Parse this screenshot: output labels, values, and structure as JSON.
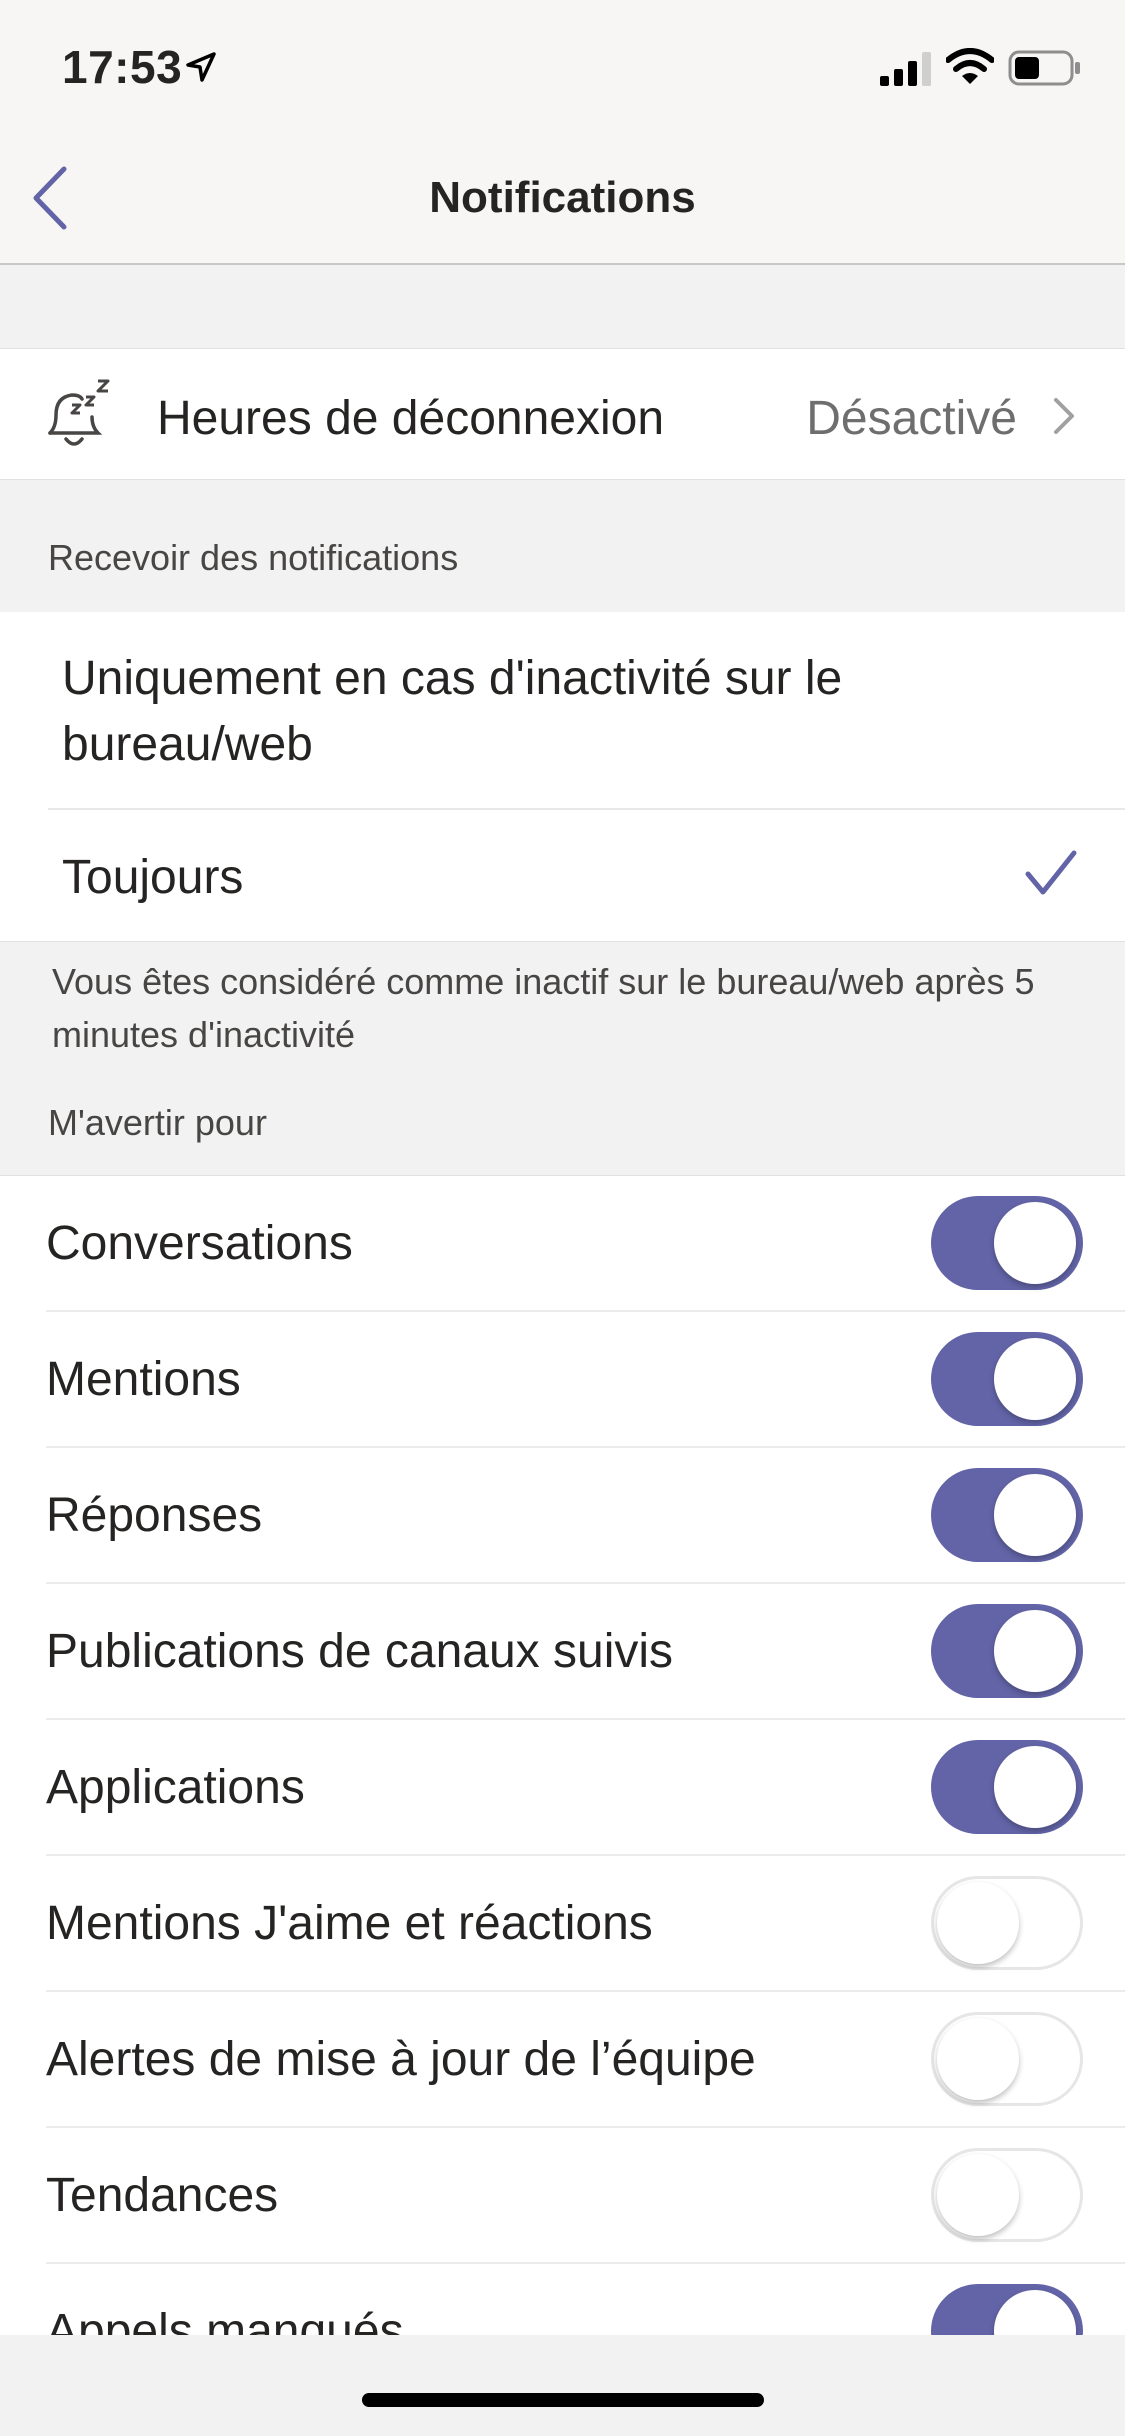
{
  "status_bar": {
    "time": "17:53"
  },
  "nav": {
    "title": "Notifications"
  },
  "quiet_hours": {
    "label": "Heures de déconnexion",
    "value": "Désactivé"
  },
  "receive_section": {
    "header": "Recevoir des notifications",
    "options": [
      {
        "label": "Uniquement en cas d'inactivité sur le bureau/web",
        "selected": false
      },
      {
        "label": "Toujours",
        "selected": true
      }
    ],
    "footnote": "Vous êtes considéré comme inactif sur le bureau/web après 5 minutes d'inactivité"
  },
  "notify_section": {
    "header": "M'avertir pour",
    "items": [
      {
        "label": "Conversations",
        "on": true
      },
      {
        "label": "Mentions",
        "on": true
      },
      {
        "label": "Réponses",
        "on": true
      },
      {
        "label": "Publications de canaux suivis",
        "on": true
      },
      {
        "label": "Applications",
        "on": true
      },
      {
        "label": "Mentions J'aime et réactions",
        "on": false
      },
      {
        "label": "Alertes de mise à jour de l’équipe",
        "on": false
      },
      {
        "label": "Tendances",
        "on": false
      },
      {
        "label": "Appels manqués",
        "on": true
      }
    ]
  },
  "colors": {
    "accent": "#6264a7",
    "background": "#f2f2f2",
    "row": "#ffffff"
  }
}
